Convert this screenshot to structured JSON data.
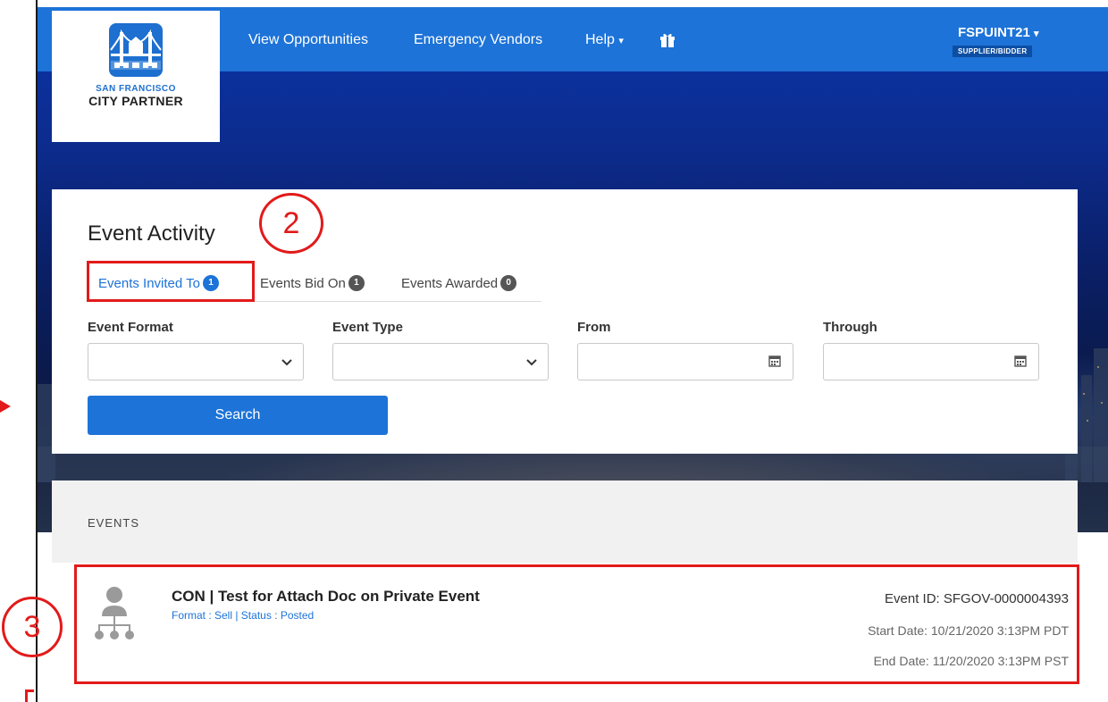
{
  "nav": {
    "links": [
      "View Opportunities",
      "Emergency Vendors",
      "Help"
    ],
    "help_caret": "▾",
    "user_name": "FSPUINT21",
    "user_caret": "▾",
    "user_role": "SUPPLIER/BIDDER"
  },
  "logo": {
    "line1": "SAN FRANCISCO",
    "line2": "CITY PARTNER",
    "icon": "golden-gate-bridge-icon"
  },
  "event_activity": {
    "title": "Event Activity",
    "tabs": [
      {
        "label": "Events Invited To",
        "count": "1",
        "active": true
      },
      {
        "label": "Events Bid On",
        "count": "1",
        "active": false
      },
      {
        "label": "Events Awarded",
        "count": "0",
        "active": false
      }
    ],
    "filters": {
      "event_format_label": "Event Format",
      "event_format_value": "",
      "event_type_label": "Event Type",
      "event_type_value": "",
      "from_label": "From",
      "from_value": "",
      "through_label": "Through",
      "through_value": ""
    },
    "search_label": "Search"
  },
  "annotations": {
    "step2": "2",
    "step3": "3",
    "color": "#e21a1a"
  },
  "events": {
    "heading": "EVENTS",
    "items": [
      {
        "title": "CON | Test for Attach Doc on Private Event",
        "subtitle": "Format : Sell | Status : Posted",
        "event_id": "Event ID: SFGOV-0000004393",
        "start_date": "Start Date: 10/21/2020  3:13PM PDT",
        "end_date": "End Date: 11/20/2020  3:13PM PST"
      }
    ]
  },
  "colors": {
    "brand_blue": "#1d73d8",
    "annotation_red": "#e21a1a"
  }
}
